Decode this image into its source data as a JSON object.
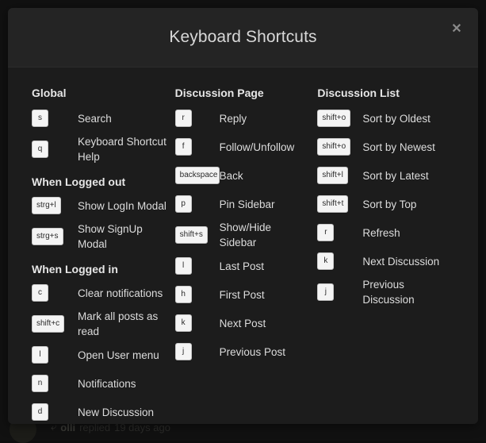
{
  "background": {
    "post_meta_icon": "reply-arrow-icon",
    "post_author": "olli",
    "post_action": "replied",
    "post_time": "19 days ago"
  },
  "modal": {
    "title": "Keyboard Shortcuts",
    "close_icon": "close-icon",
    "close_label": "✕",
    "columns": [
      {
        "title": "Global",
        "sections": [
          {
            "heading": null,
            "items": [
              {
                "key": "s",
                "label": "Search"
              },
              {
                "key": "q",
                "label": "Keyboard Shortcut Help"
              }
            ]
          },
          {
            "heading": "When Logged out",
            "items": [
              {
                "key": "strg+l",
                "label": "Show LogIn Modal"
              },
              {
                "key": "strg+s",
                "label": "Show SignUp Modal"
              }
            ]
          },
          {
            "heading": "When Logged in",
            "items": [
              {
                "key": "c",
                "label": "Clear notifications"
              },
              {
                "key": "shift+c",
                "label": "Mark all posts as read"
              },
              {
                "key": "l",
                "label": "Open User menu"
              },
              {
                "key": "n",
                "label": "Notifications"
              },
              {
                "key": "d",
                "label": "New Discussion"
              }
            ]
          }
        ]
      },
      {
        "title": "Discussion Page",
        "sections": [
          {
            "heading": null,
            "items": [
              {
                "key": "r",
                "label": "Reply"
              },
              {
                "key": "f",
                "label": "Follow/Unfollow"
              },
              {
                "key": "backspace",
                "label": "Back"
              },
              {
                "key": "p",
                "label": "Pin Sidebar"
              },
              {
                "key": "shift+s",
                "label": "Show/Hide Sidebar"
              },
              {
                "key": "l",
                "label": "Last Post"
              },
              {
                "key": "h",
                "label": "First Post"
              },
              {
                "key": "k",
                "label": "Next Post"
              },
              {
                "key": "j",
                "label": "Previous Post"
              }
            ]
          }
        ]
      },
      {
        "title": "Discussion List",
        "sections": [
          {
            "heading": null,
            "items": [
              {
                "key": "shift+o",
                "label": "Sort by Oldest"
              },
              {
                "key": "shift+o",
                "label": "Sort by Newest"
              },
              {
                "key": "shift+l",
                "label": "Sort by Latest"
              },
              {
                "key": "shift+t",
                "label": "Sort by Top"
              },
              {
                "key": "r",
                "label": "Refresh"
              },
              {
                "key": "k",
                "label": "Next Discussion"
              },
              {
                "key": "j",
                "label": "Previous Discussion"
              }
            ]
          }
        ]
      }
    ]
  },
  "colors": {
    "page_background": "#111111",
    "modal_background": "#1c1c1c",
    "modal_header_background": "#242424",
    "title_text": "#d8d8d8",
    "label_text": "#dcdcdc",
    "keycap_background": "#f4f4f4",
    "keycap_text": "#2b2b2b"
  }
}
